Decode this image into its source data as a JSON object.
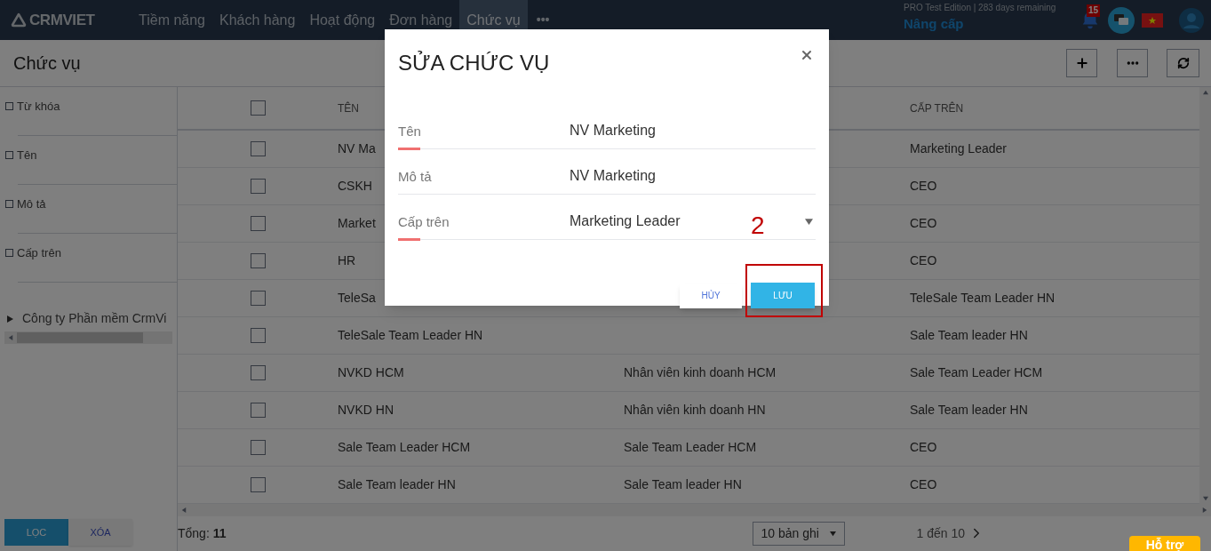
{
  "nav": {
    "logo": "CRMVIET",
    "items": [
      {
        "label": "Tiềm năng",
        "selected": false
      },
      {
        "label": "Khách hàng",
        "selected": false
      },
      {
        "label": "Hoạt động",
        "selected": false
      },
      {
        "label": "Đơn hàng",
        "selected": false
      },
      {
        "label": "Chức vụ",
        "selected": true
      }
    ],
    "more": "•••",
    "edition": "PRO Test Edition | 283 days remaining",
    "upgrade": "Nâng cấp",
    "notification_count": "15"
  },
  "page_title": "Chức vụ",
  "filters": [
    {
      "label": "Từ khóa",
      "checked": false
    },
    {
      "label": "Tên",
      "checked": false
    },
    {
      "label": "Mô tả",
      "checked": false
    },
    {
      "label": "Cấp trên",
      "checked": false
    }
  ],
  "tree": [
    {
      "label": "Công ty Phần mềm CrmVi",
      "expanded": false
    }
  ],
  "filter_buttons": {
    "apply": "LỌC",
    "clear": "XÓA"
  },
  "table": {
    "select_all_checked": false,
    "name_column": "TÊN",
    "superior_column": "CẤP TRÊN",
    "rows": [
      {
        "name": "NV Ma",
        "superior": "Marketing Leader",
        "checked": false
      },
      {
        "name": "CSKH",
        "superior": "CEO",
        "checked": false
      },
      {
        "name": "Market",
        "superior": "CEO",
        "checked": false
      },
      {
        "name": "HR",
        "superior": "CEO",
        "checked": false
      },
      {
        "name": "TeleSa",
        "superior": "TeleSale Team Leader HN",
        "checked": false
      },
      {
        "name": "TeleSale Team Leader HN",
        "superior": "Sale Team leader HN",
        "checked": false
      },
      {
        "name": "NVKD HCM",
        "description": "Nhân viên kinh doanh HCM",
        "superior": "Sale Team Leader HCM",
        "checked": false
      },
      {
        "name": "NVKD HN",
        "description": "Nhân viên kinh doanh HN",
        "superior": "Sale Team leader HN",
        "checked": false
      },
      {
        "name": "Sale Team Leader HCM",
        "description": "Sale Team Leader HCM",
        "superior": "CEO",
        "checked": false
      },
      {
        "name": "Sale Team leader HN",
        "description": "Sale Team leader HN",
        "superior": "CEO",
        "checked": false
      }
    ]
  },
  "footer": {
    "total_label": "Tổng:",
    "total": "11",
    "page_size": "10 bản ghi",
    "range": "1 đến 10",
    "support": "Hỗ trợ"
  },
  "modal": {
    "title": "SỬA CHỨC VỤ",
    "fields": [
      {
        "label": "Tên",
        "value": "NV Marketing",
        "kind": "text",
        "accent": true
      },
      {
        "label": "Mô tả",
        "value": "NV Marketing",
        "kind": "text",
        "accent": false
      },
      {
        "label": "Cấp trên",
        "value": "Marketing Leader",
        "kind": "select",
        "accent": true
      }
    ],
    "cancel": "HỦY",
    "save": "LƯU",
    "annotation": "2"
  }
}
